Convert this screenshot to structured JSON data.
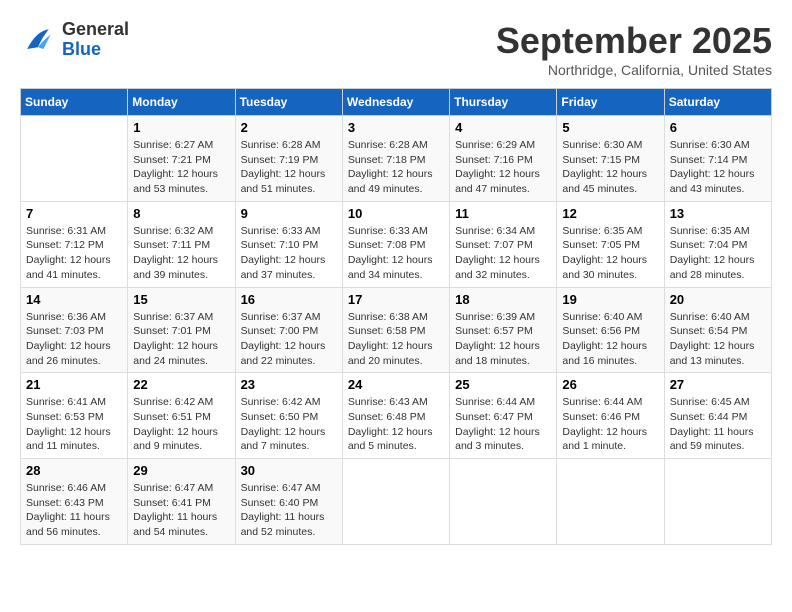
{
  "header": {
    "logo_line1": "General",
    "logo_line2": "Blue",
    "month": "September 2025",
    "location": "Northridge, California, United States"
  },
  "days_of_week": [
    "Sunday",
    "Monday",
    "Tuesday",
    "Wednesday",
    "Thursday",
    "Friday",
    "Saturday"
  ],
  "weeks": [
    [
      {
        "day": "",
        "info": ""
      },
      {
        "day": "1",
        "info": "Sunrise: 6:27 AM\nSunset: 7:21 PM\nDaylight: 12 hours\nand 53 minutes."
      },
      {
        "day": "2",
        "info": "Sunrise: 6:28 AM\nSunset: 7:19 PM\nDaylight: 12 hours\nand 51 minutes."
      },
      {
        "day": "3",
        "info": "Sunrise: 6:28 AM\nSunset: 7:18 PM\nDaylight: 12 hours\nand 49 minutes."
      },
      {
        "day": "4",
        "info": "Sunrise: 6:29 AM\nSunset: 7:16 PM\nDaylight: 12 hours\nand 47 minutes."
      },
      {
        "day": "5",
        "info": "Sunrise: 6:30 AM\nSunset: 7:15 PM\nDaylight: 12 hours\nand 45 minutes."
      },
      {
        "day": "6",
        "info": "Sunrise: 6:30 AM\nSunset: 7:14 PM\nDaylight: 12 hours\nand 43 minutes."
      }
    ],
    [
      {
        "day": "7",
        "info": "Sunrise: 6:31 AM\nSunset: 7:12 PM\nDaylight: 12 hours\nand 41 minutes."
      },
      {
        "day": "8",
        "info": "Sunrise: 6:32 AM\nSunset: 7:11 PM\nDaylight: 12 hours\nand 39 minutes."
      },
      {
        "day": "9",
        "info": "Sunrise: 6:33 AM\nSunset: 7:10 PM\nDaylight: 12 hours\nand 37 minutes."
      },
      {
        "day": "10",
        "info": "Sunrise: 6:33 AM\nSunset: 7:08 PM\nDaylight: 12 hours\nand 34 minutes."
      },
      {
        "day": "11",
        "info": "Sunrise: 6:34 AM\nSunset: 7:07 PM\nDaylight: 12 hours\nand 32 minutes."
      },
      {
        "day": "12",
        "info": "Sunrise: 6:35 AM\nSunset: 7:05 PM\nDaylight: 12 hours\nand 30 minutes."
      },
      {
        "day": "13",
        "info": "Sunrise: 6:35 AM\nSunset: 7:04 PM\nDaylight: 12 hours\nand 28 minutes."
      }
    ],
    [
      {
        "day": "14",
        "info": "Sunrise: 6:36 AM\nSunset: 7:03 PM\nDaylight: 12 hours\nand 26 minutes."
      },
      {
        "day": "15",
        "info": "Sunrise: 6:37 AM\nSunset: 7:01 PM\nDaylight: 12 hours\nand 24 minutes."
      },
      {
        "day": "16",
        "info": "Sunrise: 6:37 AM\nSunset: 7:00 PM\nDaylight: 12 hours\nand 22 minutes."
      },
      {
        "day": "17",
        "info": "Sunrise: 6:38 AM\nSunset: 6:58 PM\nDaylight: 12 hours\nand 20 minutes."
      },
      {
        "day": "18",
        "info": "Sunrise: 6:39 AM\nSunset: 6:57 PM\nDaylight: 12 hours\nand 18 minutes."
      },
      {
        "day": "19",
        "info": "Sunrise: 6:40 AM\nSunset: 6:56 PM\nDaylight: 12 hours\nand 16 minutes."
      },
      {
        "day": "20",
        "info": "Sunrise: 6:40 AM\nSunset: 6:54 PM\nDaylight: 12 hours\nand 13 minutes."
      }
    ],
    [
      {
        "day": "21",
        "info": "Sunrise: 6:41 AM\nSunset: 6:53 PM\nDaylight: 12 hours\nand 11 minutes."
      },
      {
        "day": "22",
        "info": "Sunrise: 6:42 AM\nSunset: 6:51 PM\nDaylight: 12 hours\nand 9 minutes."
      },
      {
        "day": "23",
        "info": "Sunrise: 6:42 AM\nSunset: 6:50 PM\nDaylight: 12 hours\nand 7 minutes."
      },
      {
        "day": "24",
        "info": "Sunrise: 6:43 AM\nSunset: 6:48 PM\nDaylight: 12 hours\nand 5 minutes."
      },
      {
        "day": "25",
        "info": "Sunrise: 6:44 AM\nSunset: 6:47 PM\nDaylight: 12 hours\nand 3 minutes."
      },
      {
        "day": "26",
        "info": "Sunrise: 6:44 AM\nSunset: 6:46 PM\nDaylight: 12 hours\nand 1 minute."
      },
      {
        "day": "27",
        "info": "Sunrise: 6:45 AM\nSunset: 6:44 PM\nDaylight: 11 hours\nand 59 minutes."
      }
    ],
    [
      {
        "day": "28",
        "info": "Sunrise: 6:46 AM\nSunset: 6:43 PM\nDaylight: 11 hours\nand 56 minutes."
      },
      {
        "day": "29",
        "info": "Sunrise: 6:47 AM\nSunset: 6:41 PM\nDaylight: 11 hours\nand 54 minutes."
      },
      {
        "day": "30",
        "info": "Sunrise: 6:47 AM\nSunset: 6:40 PM\nDaylight: 11 hours\nand 52 minutes."
      },
      {
        "day": "",
        "info": ""
      },
      {
        "day": "",
        "info": ""
      },
      {
        "day": "",
        "info": ""
      },
      {
        "day": "",
        "info": ""
      }
    ]
  ]
}
